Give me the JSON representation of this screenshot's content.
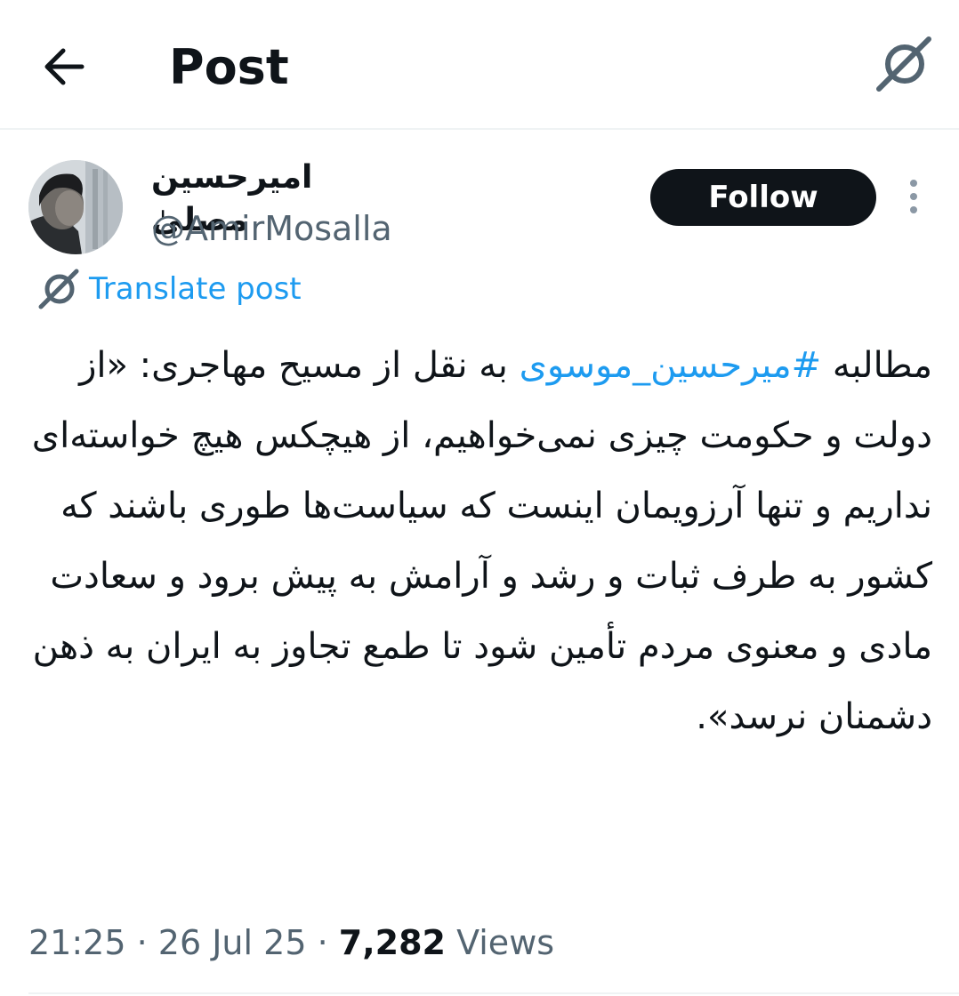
{
  "header": {
    "title": "Post",
    "back_icon": "arrow-left-icon",
    "grok_icon": "grok-icon"
  },
  "author": {
    "display_name": "امیرحسین مصلیٰ",
    "handle": "@AmirMosalla",
    "follow_label": "Follow"
  },
  "translate": {
    "label": "Translate post",
    "icon": "grok-icon"
  },
  "tweet": {
    "text_before": "مطالبه ",
    "hashtag": "#میرحسین_موسوی",
    "text_after": " به نقل از مسیح مهاجری:\n«از دولت و حکومت چیزی نمی‌خواهیم، از هیچکس هیچ خواسته‌ای نداریم و تنها آرزویمان اینست که سیاست‌ها طوری باشند که کشور به طرف ثبات و رشد و آرامش به پیش برود و سعادت مادی و معنوی مردم تأمین شود تا طمع تجاوز به ایران به ذهن دشمنان نرسد»."
  },
  "meta": {
    "time": "21:25",
    "separator": "·",
    "date": "26 Jul 25",
    "views_count": "7,282",
    "views_label": "Views"
  },
  "colors": {
    "text": "#0f1419",
    "secondary": "#536471",
    "link": "#1d9bf0",
    "divider": "#eff3f4"
  }
}
